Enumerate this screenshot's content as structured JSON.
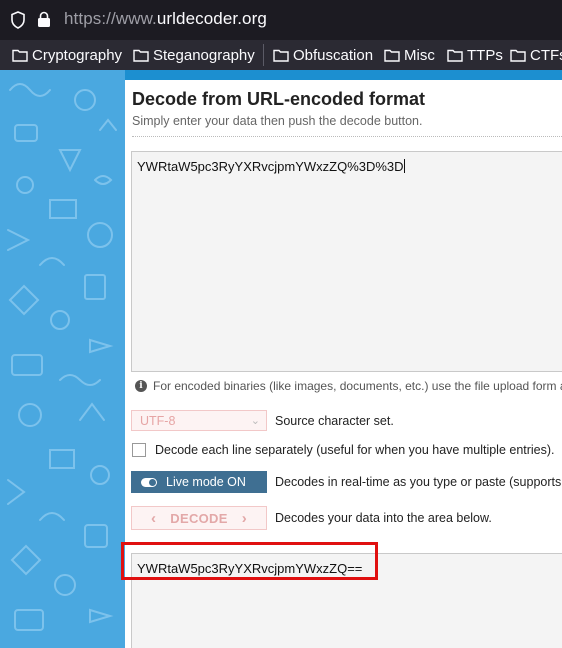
{
  "browser": {
    "url_scheme": "https://www.",
    "url_domain": "urldecoder.org",
    "bookmarks": [
      "Cryptography",
      "Steganography",
      "Obfuscation",
      "Misc",
      "TTPs",
      "CTFs"
    ]
  },
  "panel": {
    "title": "Decode from URL-encoded format",
    "subtitle": "Simply enter your data then push the decode button.",
    "input_value": "YWRtaW5pc3RyYXRvcjpmYWxzZQ%3D%3D",
    "info_text": "For encoded binaries (like images, documents, etc.) use the file upload form a",
    "charset_value": "UTF-8",
    "charset_label": "Source character set.",
    "each_line_label": "Decode each line separately (useful for when you have multiple entries).",
    "live_mode_label": "Live mode ON",
    "live_mode_desc": "Decodes in real-time as you type or paste (supports or",
    "decode_button": "DECODE",
    "decode_desc": "Decodes your data into the area below.",
    "output_value": "YWRtaW5pc3RyYXRvcjpmYWxzZQ=="
  },
  "colors": {
    "page_bg": "#1c8fd0",
    "live_button": "#3f6f92",
    "highlight": "#e01010"
  }
}
